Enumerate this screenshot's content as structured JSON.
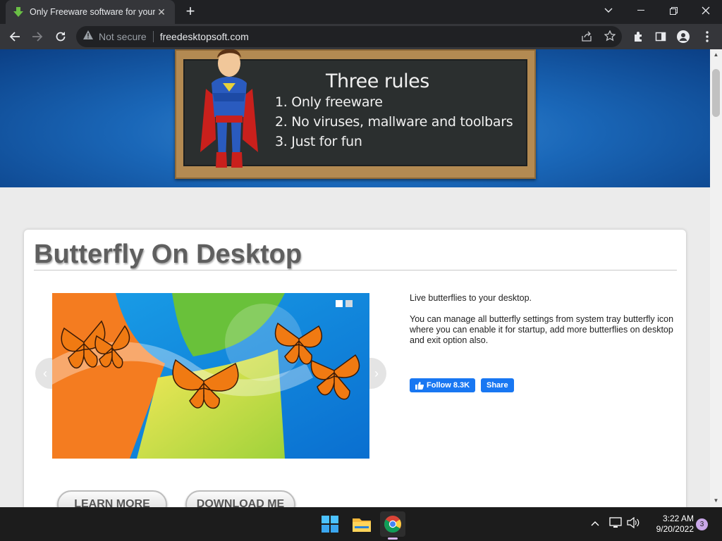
{
  "browser": {
    "tab": {
      "title": "Only Freeware software for your"
    },
    "omnibox": {
      "security_label": "Not secure",
      "url": "freedesktopsoft.com"
    }
  },
  "page": {
    "banner": {
      "title": "Three rules",
      "rules": [
        "1. Only freeware",
        "2. No viruses, mallware and toolbars",
        "3. Just for fun"
      ]
    },
    "product": {
      "title": "Butterfly On Desktop",
      "description": [
        "Live butterflies to your desktop.",
        "You can manage all butterfly settings from system tray butterfly icon where you can enable it for startup, add more butterflies on desktop and exit option also."
      ],
      "follow_label": "Follow 8.3K",
      "share_label": "Share",
      "learn_more_label": "LEARN MORE",
      "download_label": "DOWNLOAD ME"
    }
  },
  "taskbar": {
    "time": "3:22 AM",
    "date": "9/20/2022",
    "notification_count": "3"
  },
  "colors": {
    "banner_blue": "#1a67b8",
    "facebook_blue": "#1877f2",
    "chrome_dark": "#35363a"
  }
}
